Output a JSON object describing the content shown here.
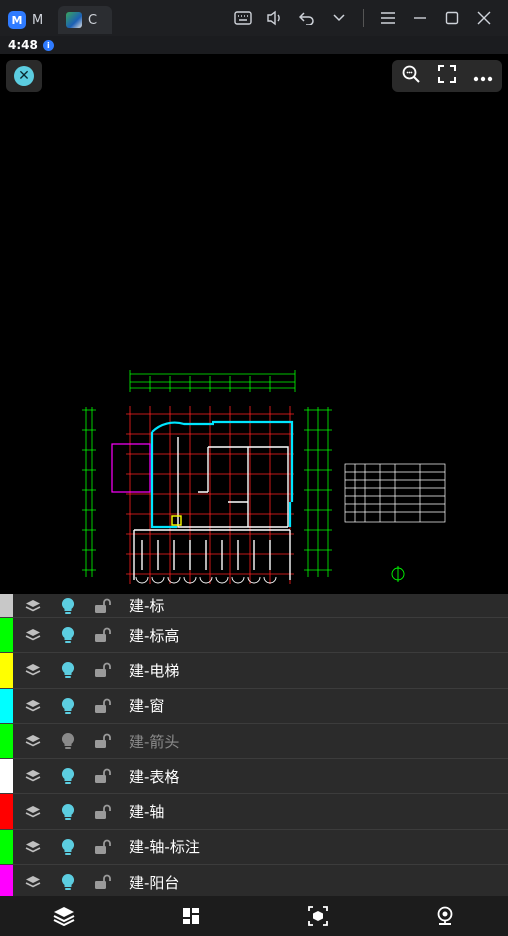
{
  "titlebar": {
    "tabs": [
      {
        "label": "M",
        "icon": "app-logo-icon"
      },
      {
        "label": "C",
        "icon": "app-thumbnail-icon"
      }
    ],
    "logo_letter": "M"
  },
  "status": {
    "time": "4:48",
    "badge": "i"
  },
  "layers": [
    {
      "name": "建-标",
      "color": "#c8c8c8",
      "visible": true,
      "partial": true
    },
    {
      "name": "建-标高",
      "color": "#00ff00",
      "visible": true
    },
    {
      "name": "建-电梯",
      "color": "#ffff00",
      "visible": true
    },
    {
      "name": "建-窗",
      "color": "#00ffff",
      "visible": true
    },
    {
      "name": "建-箭头",
      "color": "#00ff00",
      "visible": false
    },
    {
      "name": "建-表格",
      "color": "#ffffff",
      "visible": true
    },
    {
      "name": "建-轴",
      "color": "#ff0000",
      "visible": true
    },
    {
      "name": "建-轴-标注",
      "color": "#00ff00",
      "visible": true
    },
    {
      "name": "建-阳台",
      "color": "#ff00ff",
      "visible": true
    }
  ],
  "colors": {
    "accent": "#5ccde0",
    "bulb_on": "#5ccde0",
    "bulb_off": "#8a8a8a"
  }
}
